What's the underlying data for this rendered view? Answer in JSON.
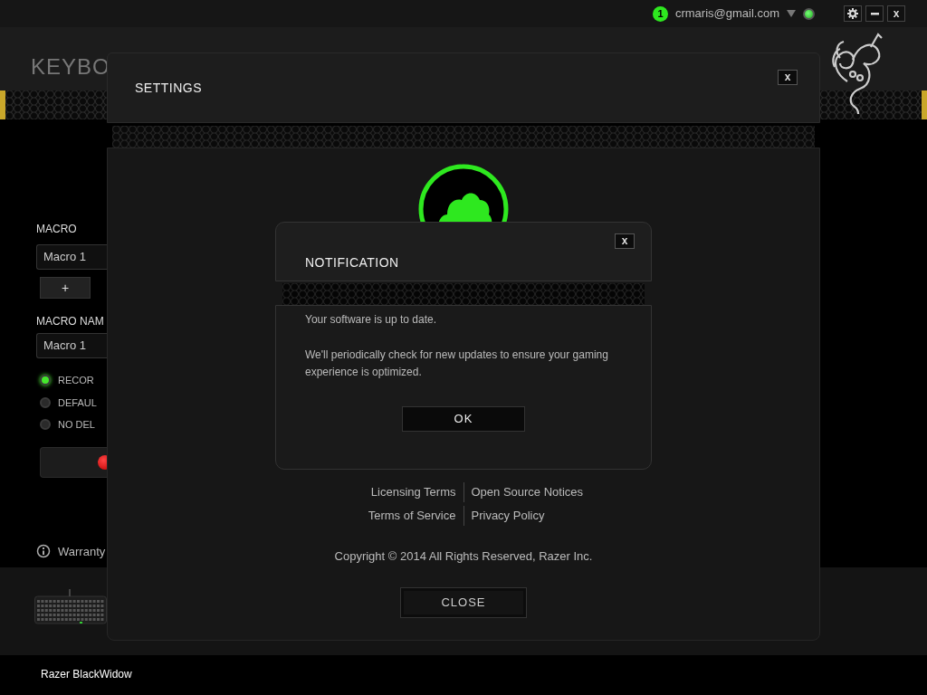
{
  "top_bar": {
    "notification_count": "1",
    "account": "crmaris@gmail.com",
    "close_label": "x"
  },
  "page": {
    "title": "KEYBO",
    "macro_label": "MACRO",
    "macro_select": "Macro 1",
    "add_button": "+",
    "macro_name_label": "MACRO NAM",
    "macro_name_value": "Macro 1",
    "options": [
      {
        "label": "RECOR",
        "selected": true
      },
      {
        "label": "DEFAUL",
        "selected": false
      },
      {
        "label": "NO DEL",
        "selected": false
      }
    ],
    "warranty": "Warranty",
    "device_name": "Razer BlackWidow"
  },
  "settings": {
    "title": "SETTINGS",
    "close_label": "x",
    "links": [
      [
        "Licensing Terms",
        "Open Source Notices"
      ],
      [
        "Terms of Service",
        "Privacy Policy"
      ]
    ],
    "copyright": "Copyright © 2014 All Rights Reserved, Razer Inc.",
    "close_button": "CLOSE"
  },
  "notification": {
    "title": "NOTIFICATION",
    "close_label": "x",
    "messages": [
      "Your software is up to date.",
      "We'll periodically check for new updates to ensure your gaming experience is optimized."
    ],
    "ok_button": "OK"
  }
}
